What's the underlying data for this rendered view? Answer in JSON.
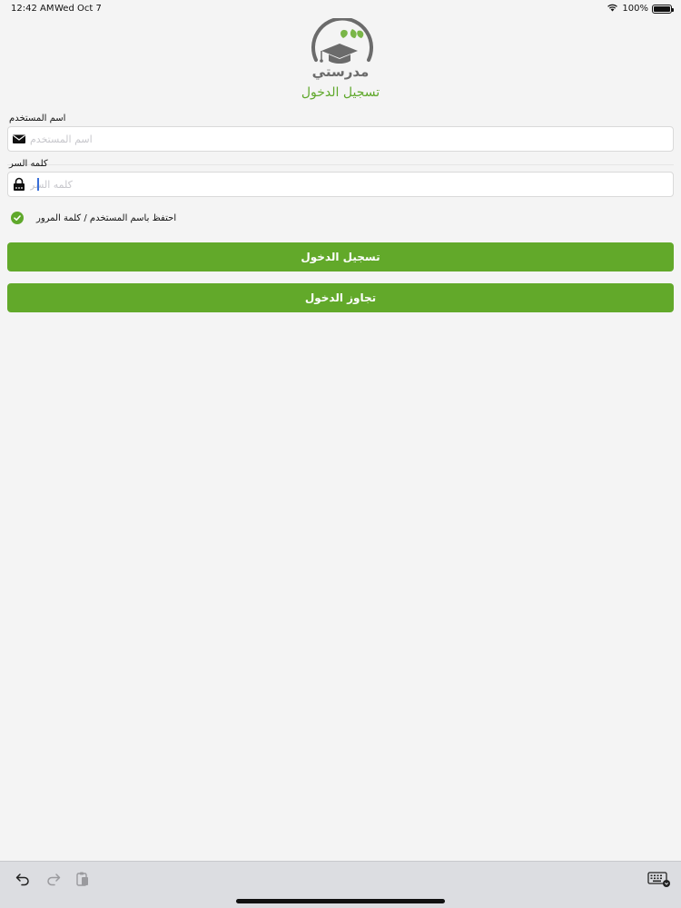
{
  "status_bar": {
    "time": "12:42 AM",
    "date": "Wed Oct 7",
    "battery": "100%"
  },
  "logo": {
    "text": "مدرستي",
    "colors": {
      "green": "#7ab648",
      "gray": "#6b6b6b"
    }
  },
  "title": "تسجيل الدخول",
  "username": {
    "label": "اسم المستخدم",
    "placeholder": "اسم المستخدم",
    "icon": "envelope-icon"
  },
  "password": {
    "label": "كلمه السر",
    "placeholder": "كلمه السر",
    "icon": "lock-icon"
  },
  "remember": {
    "label": "احتفظ باسم المستخدم / كلمة المرور",
    "checked": true
  },
  "buttons": {
    "login": "تسجيل الدخول",
    "skip": "تجاوز الدخول"
  },
  "keyboard_bar": {
    "icons": [
      "undo-icon",
      "redo-icon",
      "paste-icon",
      "keyboard-dismiss-icon"
    ]
  },
  "colors": {
    "accent": "#62a92a",
    "background": "#f4f4f4"
  }
}
